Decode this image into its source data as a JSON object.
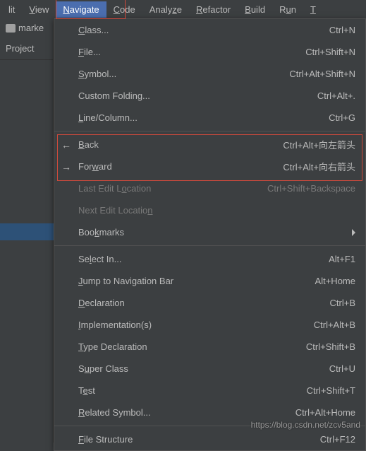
{
  "menubar": {
    "items": [
      {
        "pre": "",
        "mn": "",
        "post": "lit"
      },
      {
        "pre": "",
        "mn": "V",
        "post": "iew"
      },
      {
        "pre": "",
        "mn": "N",
        "post": "avigate",
        "active": true
      },
      {
        "pre": "",
        "mn": "C",
        "post": "ode"
      },
      {
        "pre": "Analy",
        "mn": "z",
        "post": "e"
      },
      {
        "pre": "",
        "mn": "R",
        "post": "efactor"
      },
      {
        "pre": "",
        "mn": "B",
        "post": "uild"
      },
      {
        "pre": "R",
        "mn": "u",
        "post": "n"
      },
      {
        "pre": "",
        "mn": "T",
        "post": ""
      }
    ]
  },
  "leftpanel": {
    "marke": "marke",
    "project": "Project"
  },
  "menu": {
    "class": {
      "pre": "",
      "mn": "C",
      "post": "lass...",
      "shortcut": "Ctrl+N"
    },
    "file": {
      "pre": "",
      "mn": "F",
      "post": "ile...",
      "shortcut": "Ctrl+Shift+N"
    },
    "symbol": {
      "pre": "",
      "mn": "S",
      "post": "ymbol...",
      "shortcut": "Ctrl+Alt+Shift+N"
    },
    "customfolding": {
      "pre": "Custom Foldin",
      "mn": "g",
      "post": "...",
      "shortcut": "Ctrl+Alt+."
    },
    "linecolumn": {
      "pre": "",
      "mn": "L",
      "post": "ine/Column...",
      "shortcut": "Ctrl+G"
    },
    "back": {
      "pre": "",
      "mn": "B",
      "post": "ack",
      "shortcut": "Ctrl+Alt+向左箭头"
    },
    "forward": {
      "pre": "For",
      "mn": "w",
      "post": "ard",
      "shortcut": "Ctrl+Alt+向右箭头"
    },
    "lastedit": {
      "pre": "Last Edit L",
      "mn": "o",
      "post": "cation",
      "shortcut": "Ctrl+Shift+Backspace"
    },
    "nextedit": {
      "pre": "Next Edit Locatio",
      "mn": "n",
      "post": "",
      "shortcut": ""
    },
    "bookmarks": {
      "pre": "Boo",
      "mn": "k",
      "post": "marks",
      "shortcut": ""
    },
    "selectin": {
      "pre": "Se",
      "mn": "l",
      "post": "ect In...",
      "shortcut": "Alt+F1"
    },
    "jumpnav": {
      "pre": "",
      "mn": "J",
      "post": "ump to Navigation Bar",
      "shortcut": "Alt+Home"
    },
    "declaration": {
      "pre": "",
      "mn": "D",
      "post": "eclaration",
      "shortcut": "Ctrl+B"
    },
    "implementations": {
      "pre": "",
      "mn": "I",
      "post": "mplementation(s)",
      "shortcut": "Ctrl+Alt+B"
    },
    "typedecl": {
      "pre": "",
      "mn": "T",
      "post": "ype Declaration",
      "shortcut": "Ctrl+Shift+B"
    },
    "superclass": {
      "pre": "S",
      "mn": "u",
      "post": "per Class",
      "shortcut": "Ctrl+U"
    },
    "test": {
      "pre": "T",
      "mn": "e",
      "post": "st",
      "shortcut": "Ctrl+Shift+T"
    },
    "relatedsymbol": {
      "pre": "",
      "mn": "R",
      "post": "elated Symbol...",
      "shortcut": "Ctrl+Alt+Home"
    },
    "filestructure": {
      "pre": "",
      "mn": "F",
      "post": "ile Structure",
      "shortcut": "Ctrl+F12"
    }
  },
  "watermark": "https://blog.csdn.net/zcv5and"
}
